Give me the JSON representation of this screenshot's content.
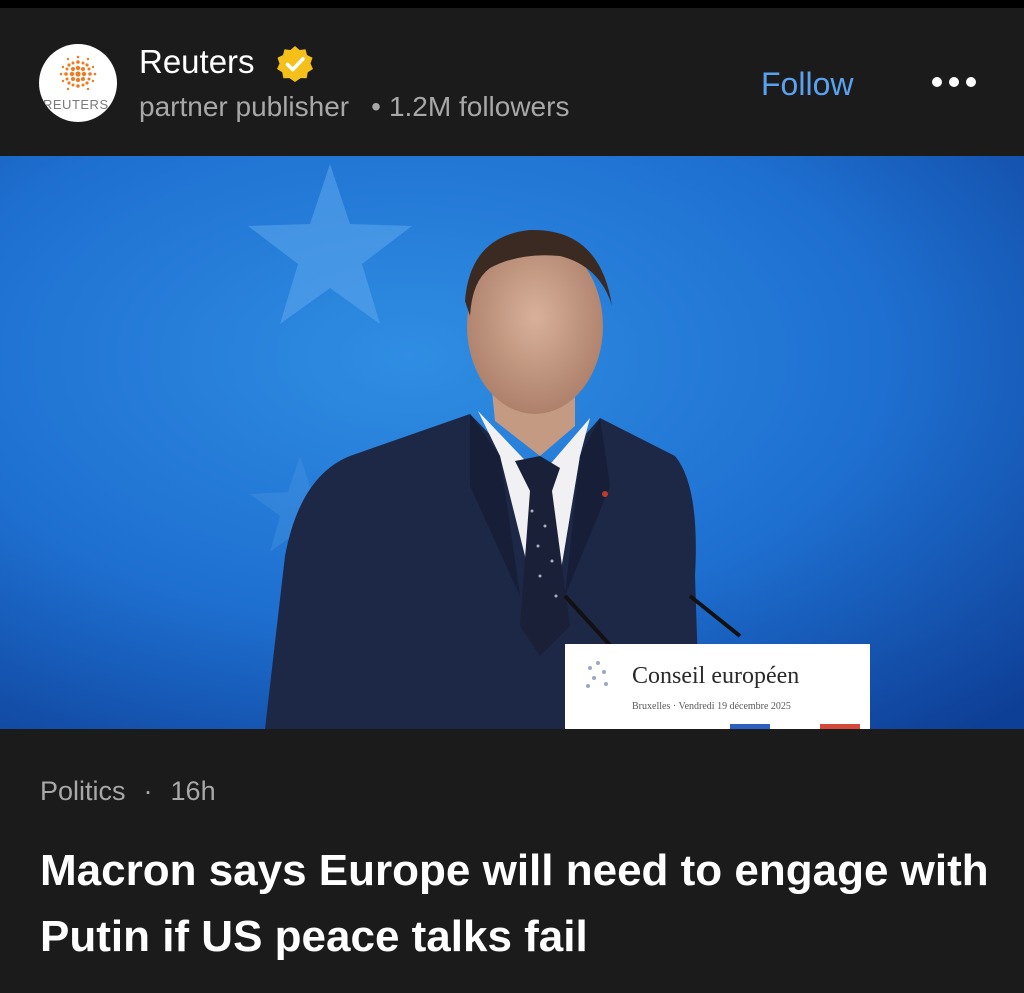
{
  "publisher": {
    "name": "Reuters",
    "logo_text": "REUTERS",
    "verified_badge_icon": "verified-check-icon",
    "subtitle": "partner publisher",
    "separator": "•",
    "followers": "1.2M followers",
    "follow_label": "Follow",
    "more_icon": "more-dots-icon"
  },
  "image": {
    "podium_text": "Conseil européen",
    "podium_subtext": "Bruxelles · Vendredi 19 décembre 2025"
  },
  "article": {
    "category": "Politics",
    "separator": "·",
    "age": "16h",
    "headline": "Macron says Europe will need to engage with Putin if US peace talks fail"
  },
  "colors": {
    "background": "#1b1b1b",
    "accent": "#5aa2f0",
    "secondary_text": "#a8a8a8",
    "verified_badge": "#f5c01a",
    "reuters_orange": "#f07a20"
  }
}
